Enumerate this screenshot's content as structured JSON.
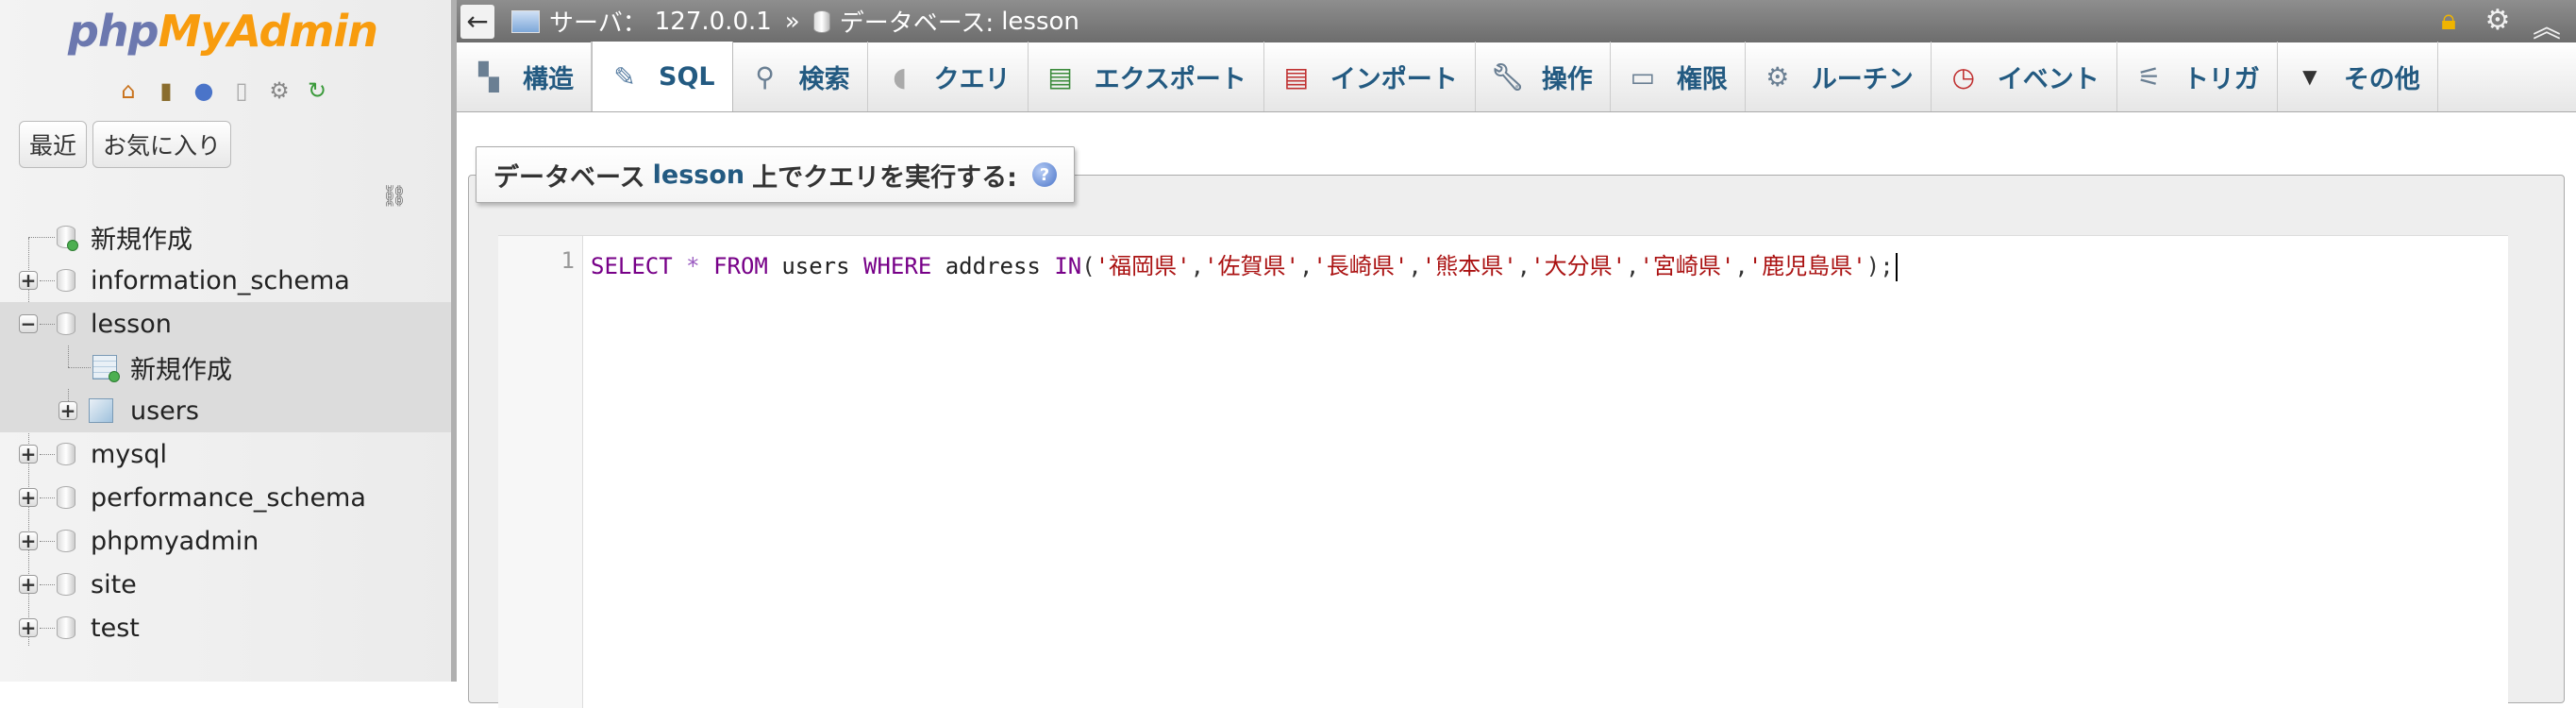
{
  "nav": {
    "logo": {
      "php": "php",
      "my": "My",
      "admin": "Admin"
    },
    "icons": [
      "home-icon",
      "exit-icon",
      "help-icon",
      "docs-icon",
      "settings-icon",
      "reload-icon"
    ],
    "buttons": {
      "recent": "最近",
      "favorites": "お気に入り"
    },
    "tree": [
      {
        "label": "新規作成",
        "type": "new-db"
      },
      {
        "label": "information_schema",
        "type": "db"
      },
      {
        "label": "lesson",
        "type": "db",
        "expanded": true
      },
      {
        "label": "新規作成",
        "type": "new-table"
      },
      {
        "label": "users",
        "type": "table"
      },
      {
        "label": "mysql",
        "type": "db"
      },
      {
        "label": "performance_schema",
        "type": "db"
      },
      {
        "label": "phpmyadmin",
        "type": "db"
      },
      {
        "label": "site",
        "type": "db"
      },
      {
        "label": "test",
        "type": "db"
      }
    ]
  },
  "topbar": {
    "back": "←",
    "server_label": "サーバ：",
    "server_value": "127.0.0.1",
    "separator": "»",
    "database_label": "データベース:",
    "database_value": "lesson"
  },
  "tabs": [
    {
      "label": "構造",
      "icon": "structure-icon"
    },
    {
      "label": "SQL",
      "icon": "sql-icon",
      "active": true
    },
    {
      "label": "検索",
      "icon": "search-icon"
    },
    {
      "label": "クエリ",
      "icon": "query-icon"
    },
    {
      "label": "エクスポート",
      "icon": "export-icon"
    },
    {
      "label": "インポート",
      "icon": "import-icon"
    },
    {
      "label": "操作",
      "icon": "wrench-icon"
    },
    {
      "label": "権限",
      "icon": "privileges-icon"
    },
    {
      "label": "ルーチン",
      "icon": "routines-icon"
    },
    {
      "label": "イベント",
      "icon": "events-icon"
    },
    {
      "label": "トリガ",
      "icon": "triggers-icon"
    },
    {
      "label": "その他",
      "icon": "more-icon"
    }
  ],
  "query": {
    "legend_prefix": "データベース",
    "legend_db": "lesson",
    "legend_suffix": "上でクエリを実行する:",
    "line_number": "1",
    "sql": {
      "select": "SELECT",
      "star": "*",
      "from": "FROM",
      "table": "users",
      "where": "WHERE",
      "column": "address",
      "in": "IN",
      "open": "(",
      "values": [
        "'福岡県'",
        "'佐賀県'",
        "'長崎県'",
        "'熊本県'",
        "'大分県'",
        "'宮崎県'",
        "'鹿児島県'"
      ],
      "close": ");"
    }
  }
}
